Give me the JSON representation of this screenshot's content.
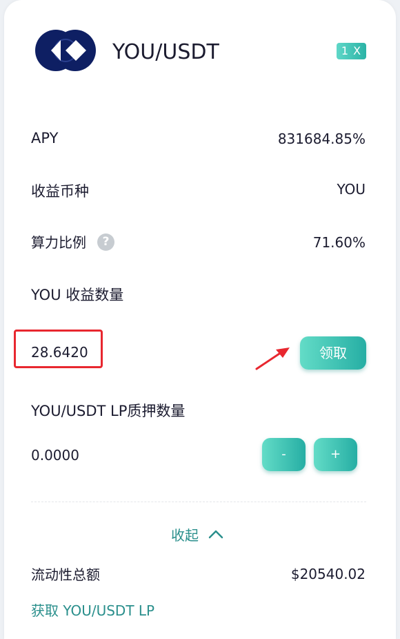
{
  "header": {
    "pair": "YOU/USDT",
    "leverage": "1 X",
    "logo_icon": "you-token-logo-icon"
  },
  "stats": {
    "apy_label": "APY",
    "apy_value": "831684.85%",
    "reward_token_label": "收益币种",
    "reward_token_value": "YOU",
    "hash_ratio_label": "算力比例",
    "hash_ratio_help": "?",
    "hash_ratio_value": "71.60%"
  },
  "earnings": {
    "label": "YOU 收益数量",
    "amount": "28.6420",
    "claim_button": "领取"
  },
  "staking": {
    "label": "YOU/USDT LP质押数量",
    "amount": "0.0000",
    "minus_button": "-",
    "plus_button": "+"
  },
  "footer": {
    "collapse_label": "收起",
    "liquidity_label": "流动性总额",
    "liquidity_value": "$20540.02",
    "get_lp_link": "获取 YOU/USDT LP"
  },
  "colors": {
    "accent": "#2bb3a6",
    "link": "#2a8f8c",
    "highlight": "#e8272f",
    "logo": "#0e1f63"
  }
}
